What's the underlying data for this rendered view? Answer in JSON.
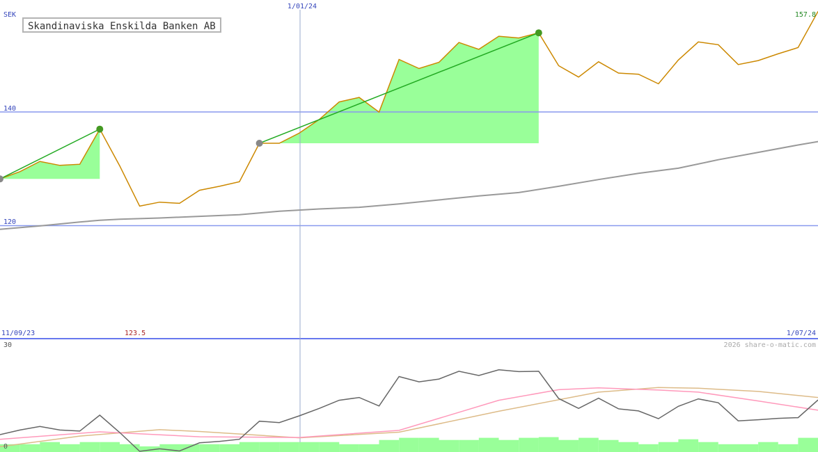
{
  "chart_data": {
    "type": "line",
    "title": "Skandinaviska Enskilda Banken AB",
    "currency_label": "SEK",
    "y_ticks": [
      {
        "label": "140",
        "value": 140
      },
      {
        "label": "120",
        "value": 120
      }
    ],
    "ylim": [
      100,
      159.8
    ],
    "last_price_label": "157.8",
    "min_price_label": "123.5",
    "date_labels": {
      "start": "11/09/23",
      "mid": "1/01/24",
      "end": "1/07/24"
    },
    "copyright": "2026 share-o-matic.com",
    "lower_y_ticks": [
      {
        "label": "30",
        "value": 30
      },
      {
        "label": "0",
        "value": 0
      }
    ],
    "lower_ylim": [
      0,
      32
    ],
    "colors": {
      "price": "#cc8800",
      "moving_average": "#999999",
      "gain_fill": "#99ff99",
      "trend_line": "#22aa22",
      "grid": "#8899ee",
      "oscillator": "#666666",
      "fast_signal": "#ff99bb",
      "slow_signal": "#ddbb88",
      "volume": "#99ff99"
    },
    "series": [
      {
        "x": [
          0,
          1,
          2,
          3,
          4,
          5,
          6,
          7,
          8,
          9,
          10,
          11,
          12,
          13,
          14,
          15,
          16,
          17,
          18,
          19,
          20,
          21,
          22,
          23,
          24,
          25,
          26,
          27,
          28,
          29,
          30,
          31,
          32,
          33,
          34,
          35,
          36,
          37,
          38,
          39,
          40,
          41
        ],
        "values": [
          128.2,
          129.5,
          131.3,
          130.6,
          130.8,
          137.0,
          130.5,
          123.4,
          124.1,
          123.9,
          126.2,
          126.9,
          127.7,
          134.5,
          134.5,
          136.3,
          138.7,
          141.8,
          142.6,
          140.0,
          149.3,
          147.7,
          148.8,
          152.3,
          151.1,
          153.4,
          153.1,
          154.0,
          148.2,
          146.2,
          148.9,
          146.9,
          146.7,
          145.0,
          149.2,
          152.4,
          151.9,
          148.4,
          149.1,
          150.3,
          151.4,
          157.8
        ]
      },
      {
        "x": [
          0,
          2,
          4,
          5,
          6,
          8,
          10,
          12,
          13,
          14,
          16,
          18,
          20,
          22,
          24,
          26,
          28,
          30,
          32,
          34,
          36,
          38,
          40,
          41
        ],
        "values": [
          119.3,
          119.9,
          120.6,
          120.9,
          121.1,
          121.3,
          121.6,
          121.9,
          122.2,
          122.5,
          122.9,
          123.2,
          123.8,
          124.5,
          125.2,
          125.8,
          126.9,
          128.1,
          129.2,
          130.1,
          131.6,
          132.9,
          134.2,
          134.8
        ]
      },
      {
        "x": [
          0,
          1,
          2,
          3,
          4,
          5,
          6,
          7,
          8,
          9,
          10,
          11,
          12,
          13,
          14,
          15,
          16,
          17,
          18,
          19,
          20,
          21,
          22,
          23,
          24,
          25,
          26,
          27,
          28,
          29,
          30,
          31,
          32,
          33,
          34,
          35,
          36,
          37,
          38,
          39,
          40,
          41
        ],
        "values": [
          4.9,
          6.2,
          7.2,
          6.2,
          5.9,
          10.4,
          5.5,
          0.2,
          0.9,
          0.3,
          2.6,
          3.0,
          3.6,
          8.7,
          8.3,
          10.2,
          12.3,
          14.6,
          15.4,
          13.0,
          21.3,
          19.8,
          20.6,
          22.8,
          21.6,
          23.2,
          22.7,
          22.8,
          15.1,
          12.3,
          15.2,
          12.2,
          11.6,
          9.4,
          12.9,
          15.0,
          13.9,
          8.8,
          9.1,
          9.5,
          9.7,
          14.7
        ]
      }
    ],
    "fast_signal": {
      "x": [
        0,
        5,
        10,
        15,
        20,
        25,
        28,
        30,
        33,
        35,
        38,
        41
      ],
      "values": [
        3.6,
        5.7,
        4.3,
        4.1,
        6.1,
        14.6,
        17.6,
        18.1,
        17.5,
        16.9,
        14.4,
        11.8
      ]
    },
    "slow_signal": {
      "x": [
        0,
        4,
        8,
        10,
        15,
        20,
        25,
        30,
        33,
        35,
        38,
        41
      ],
      "values": [
        1.5,
        4.5,
        6.3,
        5.8,
        4.0,
        5.6,
        11.5,
        16.9,
        18.2,
        18.0,
        17.1,
        15.4
      ]
    },
    "volume": [
      2.2,
      2.2,
      2.8,
      2.2,
      2.8,
      2.8,
      2.2,
      1.6,
      2.2,
      2.2,
      2.2,
      2.2,
      2.8,
      2.8,
      2.8,
      2.8,
      2.8,
      2.2,
      2.2,
      3.4,
      4.0,
      4.0,
      3.4,
      3.4,
      4.0,
      3.4,
      4.0,
      4.2,
      3.4,
      4.0,
      3.4,
      2.8,
      2.2,
      2.8,
      3.6,
      2.8,
      2.2,
      2.2,
      2.8,
      2.2,
      4.0,
      4.0
    ],
    "trend_segments": [
      {
        "start_index": 0,
        "end_index": 5
      },
      {
        "start_index": 13,
        "end_index": 27
      }
    ],
    "legend_placement": "none",
    "grid": true
  }
}
